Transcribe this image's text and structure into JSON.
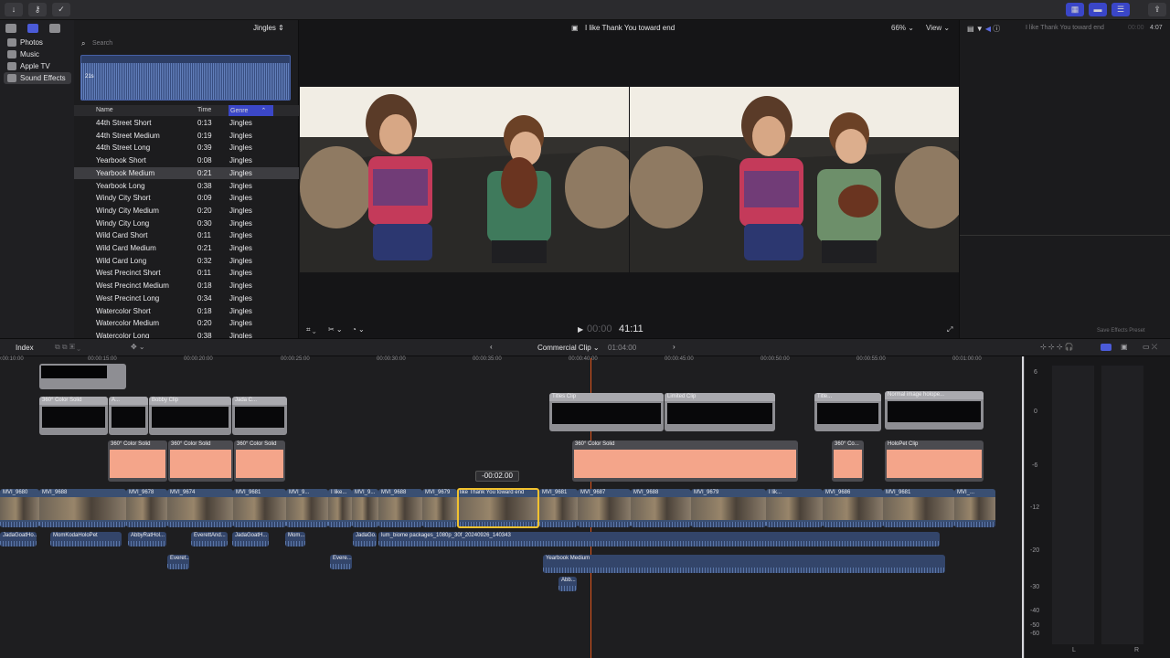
{
  "toolbar": {
    "right_icons": [
      "grid-view-icon",
      "list-view-icon",
      "inspector-toggle-icon",
      "share-icon"
    ]
  },
  "sidebar": {
    "items": [
      {
        "label": "Photos"
      },
      {
        "label": "Music"
      },
      {
        "label": "Apple TV"
      },
      {
        "label": "Sound Effects"
      }
    ]
  },
  "browser": {
    "collection": "Jingles",
    "search_placeholder": "Search",
    "waveform_duration": "21s",
    "columns": {
      "name": "Name",
      "time": "Time",
      "genre": "Genre"
    },
    "rows": [
      {
        "name": "44th Street Short",
        "time": "0:13",
        "genre": "Jingles"
      },
      {
        "name": "44th Street Medium",
        "time": "0:19",
        "genre": "Jingles"
      },
      {
        "name": "44th Street Long",
        "time": "0:39",
        "genre": "Jingles"
      },
      {
        "name": "Yearbook Short",
        "time": "0:08",
        "genre": "Jingles"
      },
      {
        "name": "Yearbook Medium",
        "time": "0:21",
        "genre": "Jingles"
      },
      {
        "name": "Yearbook Long",
        "time": "0:38",
        "genre": "Jingles"
      },
      {
        "name": "Windy City Short",
        "time": "0:09",
        "genre": "Jingles"
      },
      {
        "name": "Windy City Medium",
        "time": "0:20",
        "genre": "Jingles"
      },
      {
        "name": "Windy City Long",
        "time": "0:30",
        "genre": "Jingles"
      },
      {
        "name": "Wild Card Short",
        "time": "0:11",
        "genre": "Jingles"
      },
      {
        "name": "Wild Card Medium",
        "time": "0:21",
        "genre": "Jingles"
      },
      {
        "name": "Wild Card Long",
        "time": "0:32",
        "genre": "Jingles"
      },
      {
        "name": "West Precinct Short",
        "time": "0:11",
        "genre": "Jingles"
      },
      {
        "name": "West Precinct Medium",
        "time": "0:18",
        "genre": "Jingles"
      },
      {
        "name": "West Precinct Long",
        "time": "0:34",
        "genre": "Jingles"
      },
      {
        "name": "Watercolor Short",
        "time": "0:18",
        "genre": "Jingles"
      },
      {
        "name": "Watercolor Medium",
        "time": "0:20",
        "genre": "Jingles"
      },
      {
        "name": "Watercolor Long",
        "time": "0:38",
        "genre": "Jingles"
      }
    ]
  },
  "viewer": {
    "title": "I like Thank You toward end",
    "zoom": "66%",
    "view_menu": "View",
    "timecode_dim": "00:00",
    "timecode": "41:11"
  },
  "inspector": {
    "title": "I like Thank You toward end",
    "duration": "4:07",
    "duration_dim": "00:00",
    "save_preset": "Save Effects Preset"
  },
  "timeline": {
    "index_label": "Index",
    "project_name": "Commercial Clip",
    "project_duration": "01:04:00",
    "ruler": [
      "00:00:10:00",
      "00:00:15:00",
      "00:00:20:00",
      "00:00:25:00",
      "00:00:30:00",
      "00:00:35:00",
      "00:00:40:00",
      "00:00:45:00",
      "00:00:50:00",
      "00:00:55:00",
      "00:01:00:00"
    ],
    "trim_readout": "-00:02.00",
    "title_clips": [
      "360° Color Solid",
      "A...",
      "Bobby Clip",
      "Jada C...",
      "Titles Clip",
      "Limited Clip",
      "Title...",
      "Normal image holope..."
    ],
    "salmon_clips": [
      "360° Color Solid",
      "360° Color Solid",
      "360° Color Solid",
      "360° Color Solid",
      "360° Co...",
      "HoloPet Clip"
    ],
    "video_clips": [
      "MVI_9680",
      "MVI_9688",
      "MVI_9678",
      "MVI_9674",
      "MVI_9681",
      "MVI_9...",
      "I like...",
      "MVI_9...",
      "MVI_9688",
      "MVI_9679",
      "like Thank You toward end",
      "MVI_9681",
      "MVI_9687",
      "MVI_9688",
      "MVI_9679",
      "I lik...",
      "MVI_9686",
      "MVI_9681",
      "MVI_..."
    ],
    "audio_clips": [
      "JadaGoatHo...",
      "MomKodaHoloPet",
      "AbbyRatHol...",
      "EverettAnd...",
      "JadaGoatH...",
      "Mom...",
      "JadaGo...",
      "lum_biome packages_1080p_30f_20240926_140343"
    ],
    "audio_clips_2": [
      "Everet...",
      "Evere...",
      "Yearbook Medium",
      "Abb..."
    ]
  },
  "meters": {
    "scale": [
      "6",
      "0",
      "-6",
      "-12",
      "-20",
      "-30",
      "-40",
      "-50",
      "-60"
    ],
    "channels": [
      "L",
      "R"
    ]
  }
}
